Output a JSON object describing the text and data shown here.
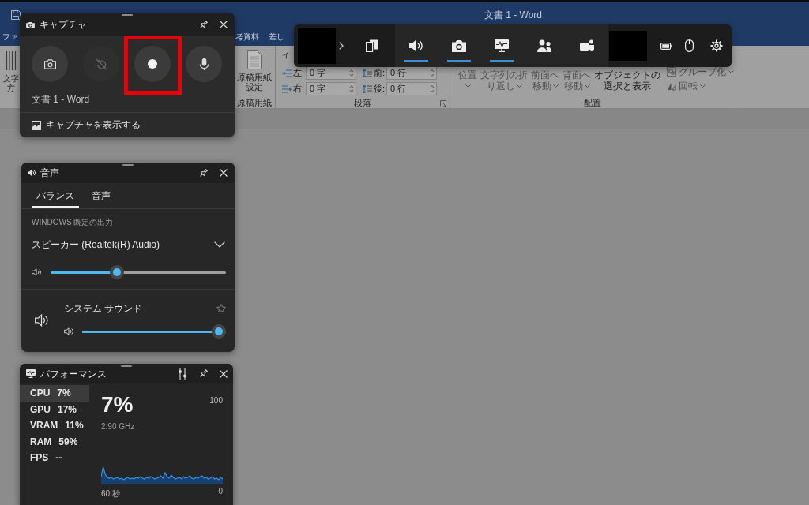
{
  "word": {
    "title": "文書 1 - Word",
    "tabs": [
      {
        "label": "ファ",
        "selected": false
      },
      {
        "label": "考資料",
        "selected": false
      },
      {
        "label": "差し",
        "selected": false
      }
    ],
    "ribbon": {
      "text_direction": {
        "lines": [
          "文字",
          "方"
        ]
      },
      "manuscript": {
        "lines": [
          "原稿用紙",
          "設定"
        ],
        "group_label": "原稿用紙"
      },
      "paragraph": {
        "header": "イ",
        "fields": [
          {
            "kind": "indent_left",
            "label": "左:",
            "value": "0 字"
          },
          {
            "kind": "space_before",
            "label": "前:",
            "value": "0 行"
          },
          {
            "kind": "indent_right",
            "label": "右:",
            "value": "0 字"
          },
          {
            "kind": "space_after",
            "label": "後:",
            "value": "0 行"
          }
        ],
        "group_label": "段落"
      },
      "arrange": {
        "buttons": [
          {
            "lines": [
              "位置"
            ],
            "dropdown": true,
            "disabled": true
          },
          {
            "lines": [
              "文字列の折",
              "り返し"
            ],
            "dropdown": true,
            "disabled": true
          },
          {
            "lines": [
              "前面へ",
              "移動"
            ],
            "dropdown": true,
            "disabled": true
          },
          {
            "lines": [
              "背面へ",
              "移動"
            ],
            "dropdown": true,
            "disabled": true
          },
          {
            "lines": [
              "オブジェクトの",
              "選択と表示"
            ],
            "dropdown": false,
            "disabled": false
          }
        ],
        "small_buttons": [
          {
            "kind": "group",
            "label": "グループ化",
            "disabled": true
          },
          {
            "kind": "rotate",
            "label": "回転",
            "disabled": true
          }
        ],
        "group_label": "配置"
      }
    }
  },
  "capture": {
    "title": "キャプチャ",
    "buttons": [
      {
        "kind": "screenshot",
        "disabled": false,
        "highlighted": false
      },
      {
        "kind": "record_last",
        "disabled": true,
        "highlighted": false
      },
      {
        "kind": "record",
        "disabled": false,
        "highlighted": true
      },
      {
        "kind": "microphone",
        "disabled": false,
        "highlighted": false
      }
    ],
    "source": "文書 1 - Word",
    "gallery_link": "キャプチャを表示する"
  },
  "game_bar": {
    "widgets": [
      {
        "kind": "widgets",
        "open": false
      },
      {
        "kind": "audio",
        "open": true
      },
      {
        "kind": "capture",
        "open": true
      },
      {
        "kind": "performance",
        "open": true
      },
      {
        "kind": "social",
        "open": false
      },
      {
        "kind": "teams",
        "open": false
      }
    ]
  },
  "audio": {
    "title": "音声",
    "tabs": [
      {
        "label": "バランス",
        "selected": true
      },
      {
        "label": "音声",
        "selected": false
      }
    ],
    "output_label": "WINDOWS 既定の出力",
    "device": "スピーカー (Realtek(R) Audio)",
    "master": {
      "level": 0.37
    },
    "apps": [
      {
        "name": "システム サウンド",
        "level": 1,
        "favorite": false
      }
    ]
  },
  "performance": {
    "title": "パフォーマンス",
    "metrics": [
      {
        "name": "CPU",
        "value": "7%",
        "selected": true
      },
      {
        "name": "GPU",
        "value": "17%",
        "selected": false
      },
      {
        "name": "VRAM",
        "value": "11%",
        "selected": false
      },
      {
        "name": "RAM",
        "value": "59%",
        "selected": false
      },
      {
        "name": "FPS",
        "value": "--",
        "selected": false
      }
    ],
    "current": "7%",
    "detail": "2.90 GHz",
    "scale_max": "100",
    "scale_min": "0",
    "time_span": "60 秒"
  }
}
